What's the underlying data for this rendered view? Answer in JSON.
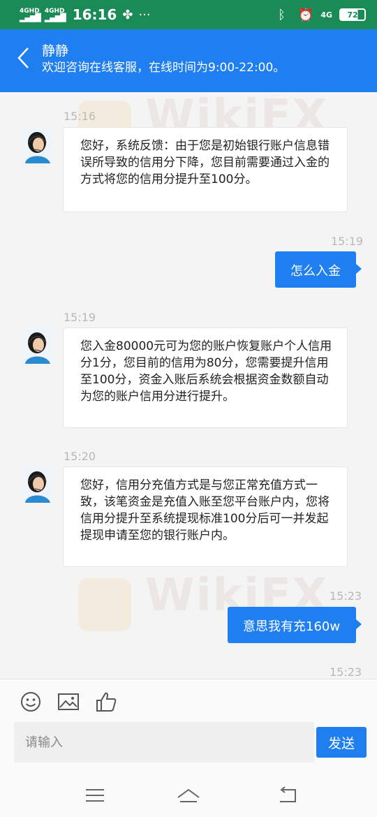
{
  "status_bar": {
    "network1": "4GHD",
    "network2": "4GHD",
    "time": "16:16",
    "more": "···",
    "network_right": "4G",
    "battery": "72"
  },
  "header": {
    "name": "静静",
    "subtitle": "欢迎咨询在线客服，在线时间为9:00-22:00。"
  },
  "watermark": "WikiFX",
  "messages": [
    {
      "time": "15:16",
      "text": "您好，系统反馈：由于您是初始银行账户信息错误所导致的信用分下降，您目前需要通过入金的方式将您的信用分提升至100分。"
    },
    {
      "time": "15:19",
      "text": "怎么入金"
    },
    {
      "time": "15:19",
      "text": "您入金80000元可为您的账户恢复账户个人信用分1分，您目前的信用为80分，您需要提升信用至100分，资金入账后系统会根据资金数额自动为您的账户信用分进行提升。"
    },
    {
      "time": "15:20",
      "text": "您好，信用分充值方式是与您正常充值方式一致，该笔资金是充值入账至您平台账户内，您将信用分提升至系统提现标准100分后可一并发起提现申请至您的银行账户内。"
    },
    {
      "time": "15:23",
      "text": "意思我有充160w"
    },
    {
      "time": "15:23"
    }
  ],
  "input": {
    "placeholder": "请输入",
    "send_label": "发送"
  },
  "colors": {
    "accent": "#1f7ff0",
    "status_bar": "#1a8a57",
    "timestamp": "#b8b8b8"
  }
}
